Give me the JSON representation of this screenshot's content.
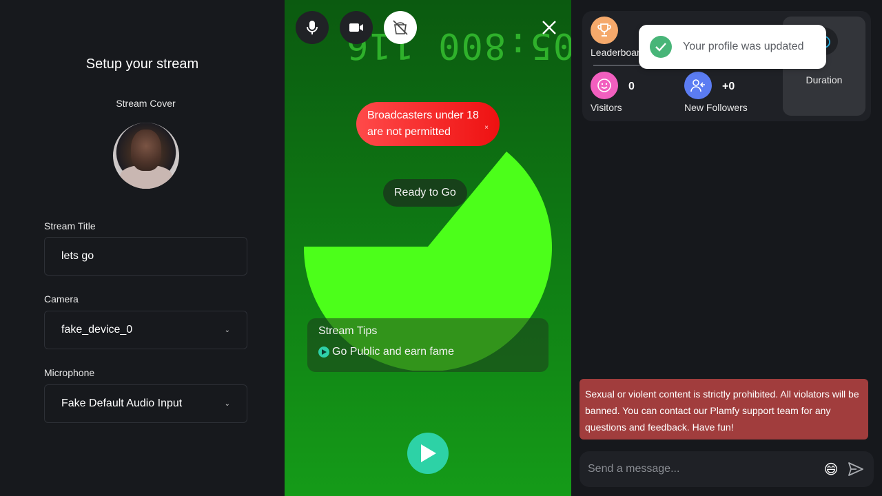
{
  "setup": {
    "title": "Setup your stream",
    "cover_label": "Stream Cover",
    "title_label": "Stream Title",
    "title_value": "lets go",
    "camera_label": "Camera",
    "camera_value": "fake_device_0",
    "mic_label": "Microphone",
    "mic_value": "Fake Default Audio Input"
  },
  "preview": {
    "digits": "205:800 116",
    "warning": "Broadcasters under 18 are not permitted",
    "warning_close": "×",
    "ready": "Ready to Go",
    "tips_title": "Stream Tips",
    "tips_item": "Go Public and earn fame"
  },
  "stats": {
    "leaderboard_label": "Leaderboard",
    "visitors_value": "0",
    "visitors_label": "Visitors",
    "followers_value": "+0",
    "followers_label": "New Followers",
    "duration_label": "Duration"
  },
  "toast": {
    "message": "Your profile was updated"
  },
  "notice": "Sexual or violent content is strictly prohibited. All violators will be banned. You can contact our Plamfy support team for any questions and feedback. Have fun!",
  "chat": {
    "placeholder": "Send a message...",
    "emoji": "😄"
  },
  "colors": {
    "accent": "#2dd2a6",
    "danger": "#ee1111",
    "notice_bg": "#a13d3d",
    "toast_ok": "#48b578"
  }
}
